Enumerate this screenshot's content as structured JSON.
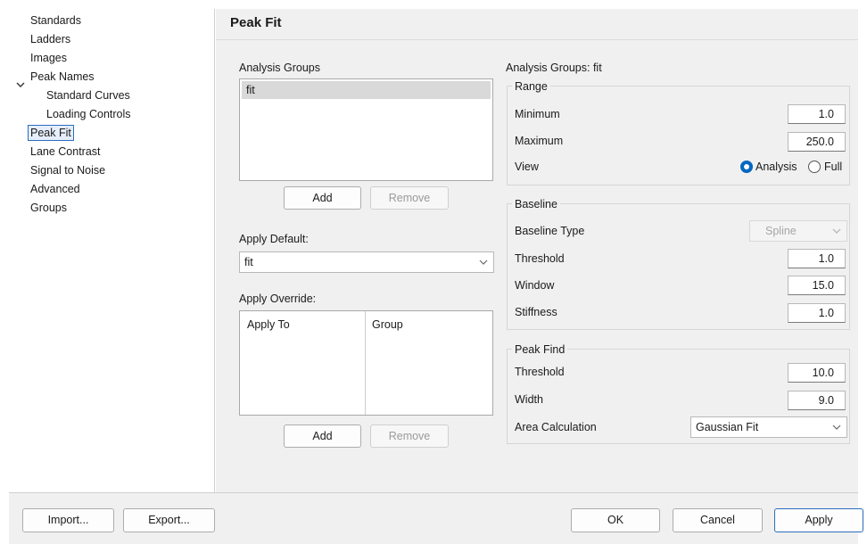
{
  "sidebar": {
    "items": [
      {
        "label": "Standards"
      },
      {
        "label": "Ladders"
      },
      {
        "label": "Images"
      },
      {
        "label": "Peak Names"
      },
      {
        "label": "Standard Curves"
      },
      {
        "label": "Loading Controls"
      },
      {
        "label": "Peak Fit"
      },
      {
        "label": "Lane Contrast"
      },
      {
        "label": "Signal to Noise"
      },
      {
        "label": "Advanced"
      },
      {
        "label": "Groups"
      }
    ],
    "selected": "Peak Fit"
  },
  "page": {
    "title": "Peak Fit"
  },
  "analysis_groups": {
    "heading": "Analysis Groups",
    "items": [
      "fit"
    ],
    "add_label": "Add",
    "remove_label": "Remove"
  },
  "apply_default": {
    "label": "Apply Default:",
    "value": "fit"
  },
  "apply_override": {
    "label": "Apply Override:",
    "columns": [
      "Apply To",
      "Group"
    ],
    "add_label": "Add",
    "remove_label": "Remove"
  },
  "settings": {
    "heading": "Analysis Groups: fit",
    "range": {
      "title": "Range",
      "minimum_label": "Minimum",
      "minimum_value": "1.0",
      "maximum_label": "Maximum",
      "maximum_value": "250.0",
      "view_label": "View",
      "view_options": [
        "Analysis",
        "Full"
      ],
      "view_selected": "Analysis"
    },
    "baseline": {
      "title": "Baseline",
      "type_label": "Baseline Type",
      "type_value": "Spline",
      "threshold_label": "Threshold",
      "threshold_value": "1.0",
      "window_label": "Window",
      "window_value": "15.0",
      "stiffness_label": "Stiffness",
      "stiffness_value": "1.0"
    },
    "peak_find": {
      "title": "Peak Find",
      "threshold_label": "Threshold",
      "threshold_value": "10.0",
      "width_label": "Width",
      "width_value": "9.0",
      "area_label": "Area Calculation",
      "area_value": "Gaussian Fit"
    }
  },
  "footer": {
    "import_label": "Import...",
    "export_label": "Export...",
    "ok_label": "OK",
    "cancel_label": "Cancel",
    "apply_label": "Apply"
  },
  "colors": {
    "accent": "#0067c0",
    "selection": "#2a6ebd",
    "panel": "#f0f0f0"
  }
}
